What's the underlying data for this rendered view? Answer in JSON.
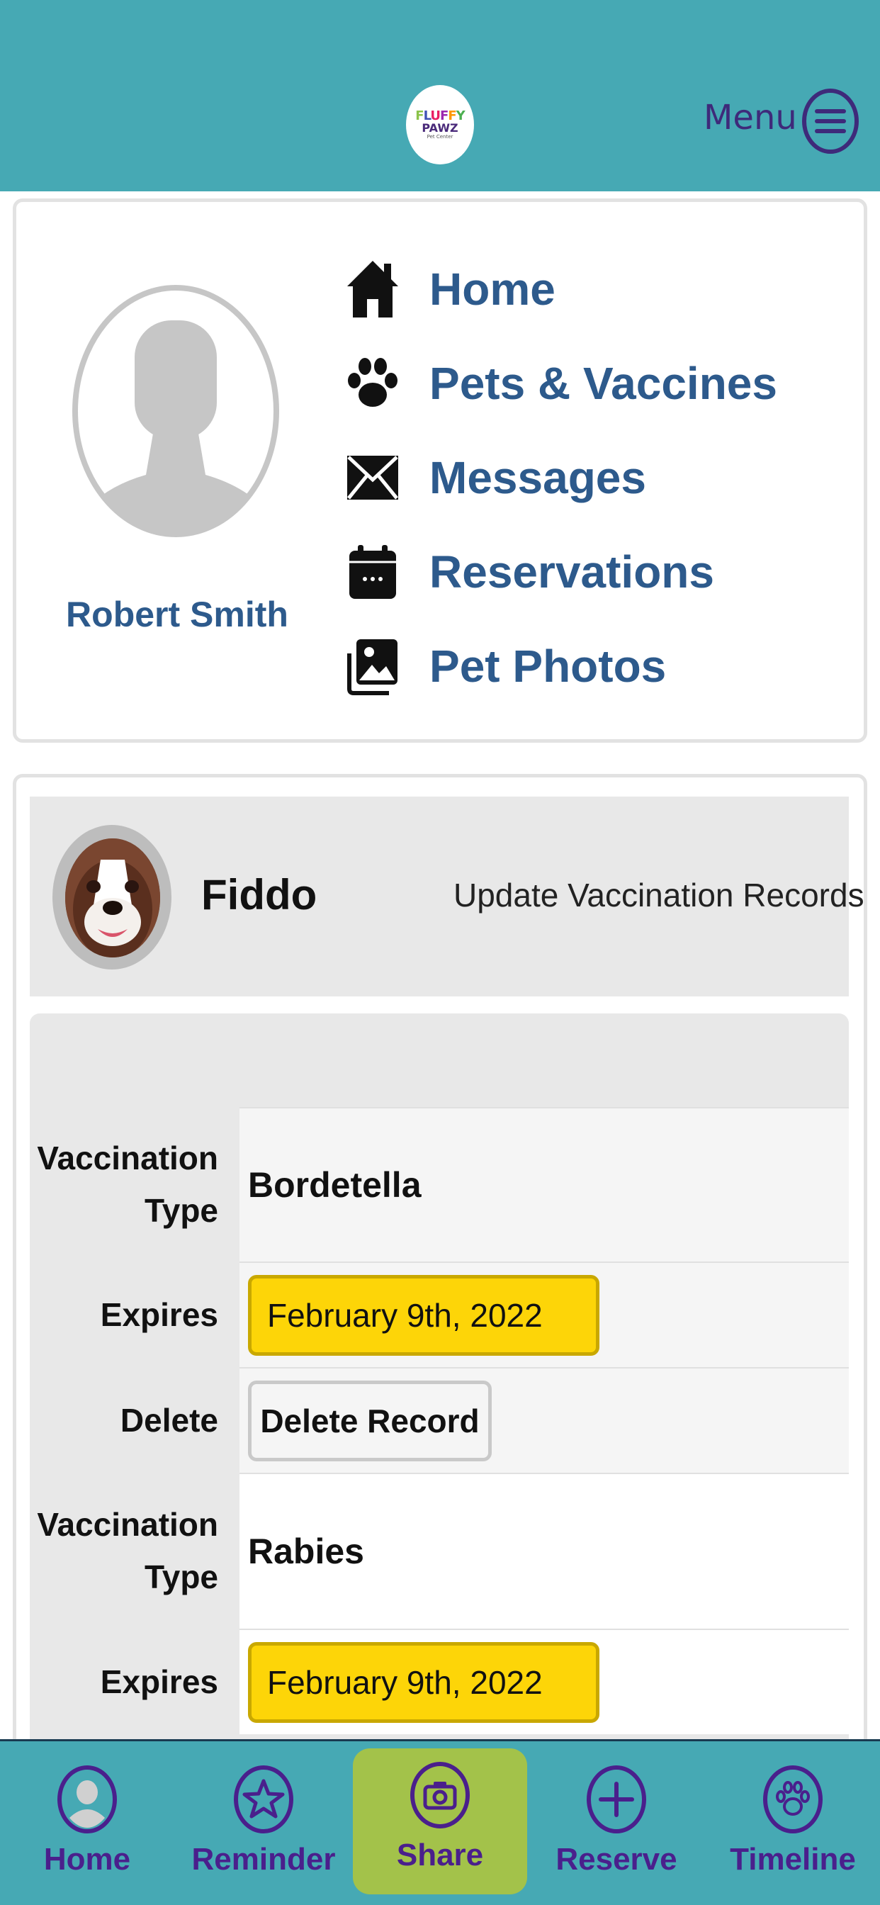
{
  "header": {
    "logo_line1": "FLUFFY",
    "logo_line2": "PAWZ",
    "logo_line3": "Pet Center",
    "menu_label": "Menu"
  },
  "profile": {
    "user_name": "Robert Smith"
  },
  "nav": {
    "items": [
      {
        "label": "Home",
        "icon": "house-icon"
      },
      {
        "label": "Pets & Vaccines",
        "icon": "paw-icon"
      },
      {
        "label": "Messages",
        "icon": "envelope-icon"
      },
      {
        "label": "Reservations",
        "icon": "calendar-icon"
      },
      {
        "label": "Pet Photos",
        "icon": "photos-icon"
      }
    ]
  },
  "pet": {
    "name": "Fiddo",
    "update_link": "Update Vaccination Records"
  },
  "vaccinations": {
    "labels": {
      "type_line1": "Vaccination",
      "type_line2": "Type",
      "expires": "Expires",
      "delete": "Delete"
    },
    "delete_button": "Delete Record",
    "records": [
      {
        "type": "Bordetella",
        "expires": "February 9th, 2022"
      },
      {
        "type": "Rabies",
        "expires": "February 9th, 2022"
      }
    ]
  },
  "bottom_nav": {
    "items": [
      {
        "label": "Home",
        "icon": "user-circle-icon"
      },
      {
        "label": "Reminder",
        "icon": "star-circle-icon"
      },
      {
        "label": "Share",
        "icon": "camera-circle-icon",
        "active": true
      },
      {
        "label": "Reserve",
        "icon": "plus-circle-icon"
      },
      {
        "label": "Timeline",
        "icon": "paw-circle-icon"
      }
    ]
  },
  "colors": {
    "header_bg": "#46a9b4",
    "link_blue": "#2d5a8c",
    "nav_purple": "#4a1f8c",
    "date_yellow": "#fdd508",
    "share_green": "#a3c24a"
  }
}
